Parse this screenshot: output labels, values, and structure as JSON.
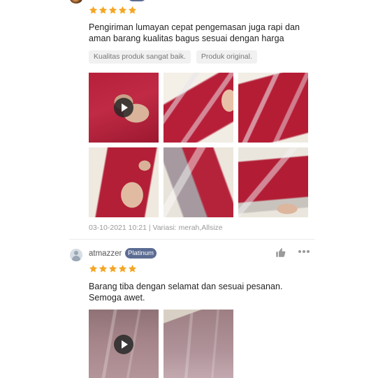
{
  "reviews": [
    {
      "rating": 5,
      "text_line1": "Pengiriman lumayan cepat pengemasan juga rapi dan",
      "text_line2": "aman barang kualitas bagus sesuai dengan harga",
      "tags": [
        "Kualitas produk sangat baik.",
        "Produk original."
      ],
      "media": [
        {
          "type": "video",
          "icon": "play-icon"
        },
        {
          "type": "photo"
        },
        {
          "type": "photo"
        },
        {
          "type": "photo"
        },
        {
          "type": "photo"
        },
        {
          "type": "photo"
        }
      ],
      "meta": "03-10-2021 10:21 | Variasi: merah,Allsize"
    },
    {
      "username": "atmazzer",
      "badge": "Platinum",
      "rating": 5,
      "text_line1": "Barang tiba dengan selamat dan sesuai pesanan.",
      "text_line2": "Semoga awet.",
      "media": [
        {
          "type": "video",
          "icon": "play-icon"
        },
        {
          "type": "photo"
        }
      ],
      "actions": {
        "like_icon": "thumbs-up-icon",
        "more_icon": "more-dots-icon"
      }
    }
  ],
  "colors": {
    "star": "#f5a623",
    "badge": "#5b6c93",
    "tag_bg": "#f1f1f1",
    "meta_text": "#9a9a9a"
  }
}
